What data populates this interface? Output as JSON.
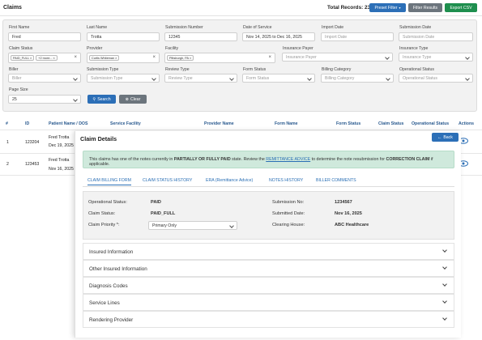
{
  "header": {
    "title": "Claims",
    "total_records": "Total Records: 23",
    "preset_filter": "Preset Filter",
    "filter_results": "Filter Results",
    "export_csv": "Export CSV",
    "colors": {
      "primary": "#2c6fb7",
      "secondary": "#6c757d",
      "success": "#1e8f4e"
    }
  },
  "filters": {
    "first_name": {
      "label": "First Name",
      "value": "Fred"
    },
    "last_name": {
      "label": "Last Name",
      "value": "Trotta"
    },
    "submission_number": {
      "label": "Submission Number",
      "value": "12345"
    },
    "date_of_service": {
      "label": "Date of Service",
      "value": "Nov 14, 2025 to Dec 16, 2025"
    },
    "import_date": {
      "label": "Import Date",
      "placeholder": "Import Date"
    },
    "submission_date": {
      "label": "Submission Date",
      "placeholder": "Submission Date"
    },
    "claim_status": {
      "label": "Claim Status",
      "chips": [
        "PAID_FULL",
        "+2 more..."
      ]
    },
    "provider": {
      "label": "Provider",
      "chips": [
        "Curtis Whiteman"
      ]
    },
    "facility": {
      "label": "Facility",
      "chips": [
        "Pittsburgh, PA"
      ]
    },
    "insurance_payer": {
      "label": "Insurance Payer",
      "placeholder": "Insurance Payer"
    },
    "insurance_type": {
      "label": "Insurance Type",
      "placeholder": "Insurance Type"
    },
    "biller": {
      "label": "Biller",
      "placeholder": "Biller"
    },
    "submission_type": {
      "label": "Submission Type",
      "placeholder": "Submission Type"
    },
    "review_type": {
      "label": "Review Type",
      "placeholder": "Review Type"
    },
    "form_status": {
      "label": "Form Status",
      "placeholder": "Form Status"
    },
    "billing_category": {
      "label": "Billing Category",
      "placeholder": "Billing Category"
    },
    "operational_status": {
      "label": "Operational Status",
      "placeholder": "Operational Status"
    },
    "page_size": {
      "label": "Page Size",
      "value": "25"
    },
    "search": "Search",
    "clear": "Clear"
  },
  "table": {
    "columns": [
      "#",
      "ID",
      "Patient Name / DOS",
      "Service Facility",
      "Provider Name",
      "Form Name",
      "Form Status",
      "Claim Status",
      "Operational Status",
      "Actions"
    ],
    "rows": [
      {
        "num": "1",
        "id": "123204",
        "patient": "Fred Trotta",
        "dos": "Dec 19, 2025"
      },
      {
        "num": "2",
        "id": "123453",
        "patient": "Fred Trotta",
        "dos": "Nov 16, 2025"
      }
    ]
  },
  "modal": {
    "title": "Claim Details",
    "back": "Back",
    "alert": {
      "pre": "This claims has one of the notes currently in ",
      "state": "PARTIALLY OR FULLY PAID",
      "mid": " state. Review the ",
      "link": "REMITTANCE ADVICE",
      "mid2": " to determine the note resubmission for ",
      "action": "CORRECTION CLAIM",
      "post": " if applicable."
    },
    "tabs": [
      "CLAIM BILLING FORM",
      "CLAIM STATUS HISTORY",
      "ERA (Remittance Advice)",
      "NOTES HISTORY",
      "BILLER COMMENTS"
    ],
    "billing": {
      "operational_status_label": "Operational Status:",
      "operational_status": "PAID",
      "claim_status_label": "Claim Status:",
      "claim_status": "PAID_FULL",
      "claim_priority_label": "Claim Priority *:",
      "claim_priority": "Primary Only",
      "submission_no_label": "Submission No:",
      "submission_no": "1234567",
      "submitted_date_label": "Submitted Date:",
      "submitted_date": "Nov 16, 2025",
      "clearing_house_label": "Clearing House:",
      "clearing_house": "ABC Healthcare"
    },
    "sections": [
      "Insured Information",
      "Other Insured Information",
      "Diagnosis Codes",
      "Service Lines",
      "Rendering Provider"
    ]
  }
}
